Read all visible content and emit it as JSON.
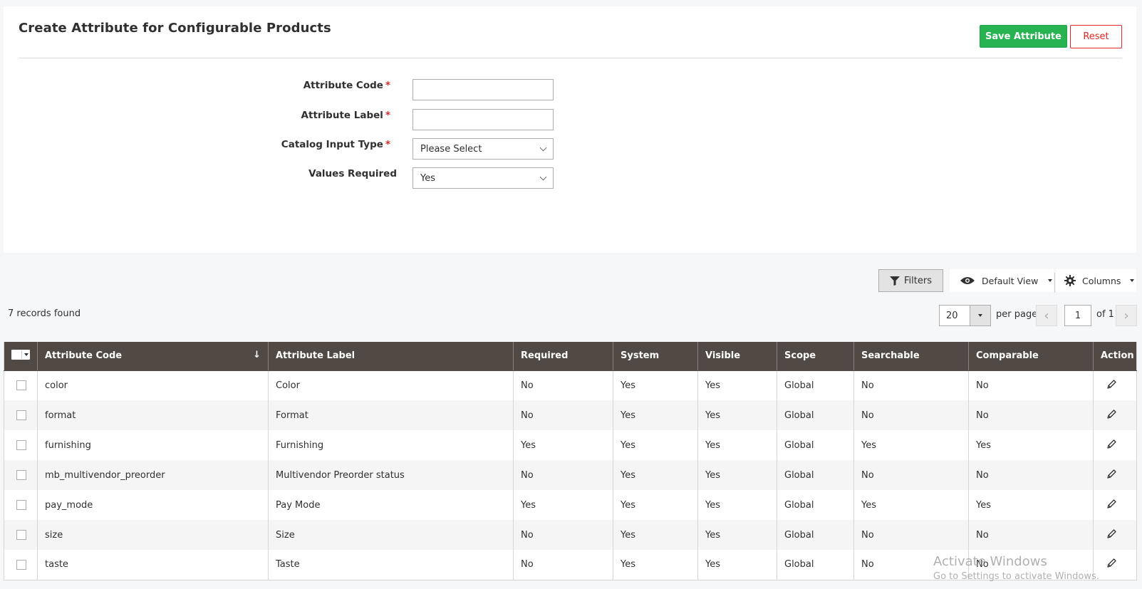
{
  "form": {
    "title": "Create Attribute for Configurable Products",
    "save_label": "Save Attribute",
    "reset_label": "Reset",
    "fields": [
      {
        "label": "Attribute Code",
        "required": true,
        "value": ""
      },
      {
        "label": "Attribute Label",
        "required": true,
        "value": ""
      },
      {
        "label": "Catalog Input Type",
        "required": true,
        "value": "Please Select"
      },
      {
        "label": "Values Required",
        "required": false,
        "value": "Yes"
      }
    ],
    "required_mark": "*"
  },
  "toolbar": {
    "filters_label": "Filters",
    "view_label": "Default View",
    "columns_label": "Columns"
  },
  "pager": {
    "records_text": "7 records found",
    "per_page_value": "20",
    "per_page_label": "per page",
    "current_page": "1",
    "of_label": "of 1"
  },
  "grid": {
    "columns": [
      "Attribute Code",
      "Attribute Label",
      "Required",
      "System",
      "Visible",
      "Scope",
      "Searchable",
      "Comparable",
      "Action"
    ],
    "rows": [
      {
        "code": "color",
        "label": "Color",
        "required": "No",
        "system": "Yes",
        "visible": "Yes",
        "scope": "Global",
        "searchable": "No",
        "comparable": "No"
      },
      {
        "code": "format",
        "label": "Format",
        "required": "No",
        "system": "Yes",
        "visible": "Yes",
        "scope": "Global",
        "searchable": "No",
        "comparable": "No"
      },
      {
        "code": "furnishing",
        "label": "Furnishing",
        "required": "Yes",
        "system": "Yes",
        "visible": "Yes",
        "scope": "Global",
        "searchable": "Yes",
        "comparable": "Yes"
      },
      {
        "code": "mb_multivendor_preorder",
        "label": "Multivendor Preorder status",
        "required": "No",
        "system": "Yes",
        "visible": "Yes",
        "scope": "Global",
        "searchable": "No",
        "comparable": "No"
      },
      {
        "code": "pay_mode",
        "label": "Pay Mode",
        "required": "Yes",
        "system": "Yes",
        "visible": "Yes",
        "scope": "Global",
        "searchable": "Yes",
        "comparable": "Yes"
      },
      {
        "code": "size",
        "label": "Size",
        "required": "No",
        "system": "Yes",
        "visible": "Yes",
        "scope": "Global",
        "searchable": "No",
        "comparable": "No"
      },
      {
        "code": "taste",
        "label": "Taste",
        "required": "No",
        "system": "Yes",
        "visible": "Yes",
        "scope": "Global",
        "searchable": "No",
        "comparable": "No"
      }
    ]
  },
  "watermark": {
    "line1": "Activate Windows",
    "line2": "Go to Settings to activate Windows."
  },
  "colors": {
    "header_bg": "#514943",
    "save_green": "#28b352",
    "reset_red": "#e22626"
  },
  "icons": [
    "filter-icon",
    "eye-icon",
    "gear-icon",
    "pencil-icon",
    "chevron-down-icon",
    "sort-arrow-icon"
  ]
}
